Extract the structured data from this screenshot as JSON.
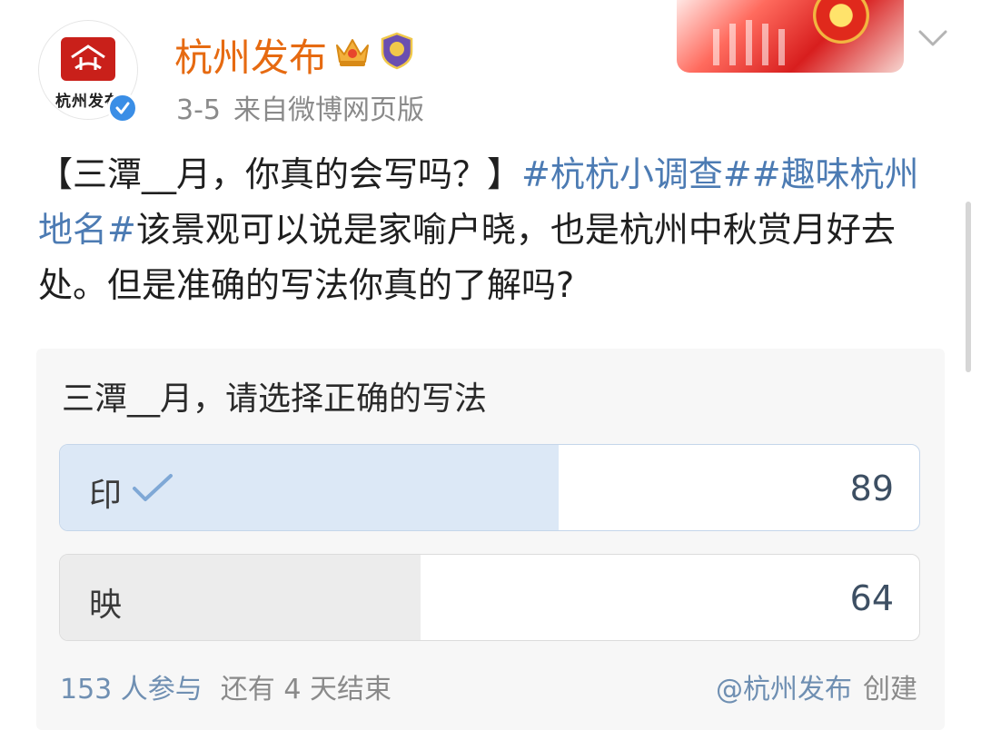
{
  "post_header": {
    "username": "杭州发布",
    "avatar_text": "杭州发布",
    "date": "3-5",
    "source": "来自微博网页版",
    "badges": [
      "crown-badge-icon",
      "shield-badge-icon"
    ]
  },
  "post": {
    "segments": [
      {
        "text": "【三潭__月，你真的会写吗？】",
        "type": "text"
      },
      {
        "text": "#杭杭小调查#",
        "type": "tag"
      },
      {
        "text": "#趣味杭州地名#",
        "type": "tag"
      },
      {
        "text": "该景观可以说是家喻户晓，也是杭州中秋赏月好去处。但是准确的写法你真的了解吗?",
        "type": "text"
      }
    ]
  },
  "poll": {
    "question": "三潭__月，请选择正确的写法",
    "options": [
      {
        "label": "印",
        "count": "89",
        "voted": true,
        "fraction": 0.58
      },
      {
        "label": "映",
        "count": "64",
        "voted": false,
        "fraction": 0.42
      }
    ],
    "participants": "153 人参与",
    "remaining": "还有 4 天结束",
    "creator": "@杭州发布",
    "created_label": "创建"
  },
  "colors": {
    "username": "#e66a11",
    "hashtag": "#4c7bb3",
    "voted_fill": "#dce8f6",
    "other_fill": "#ececec",
    "checkmark": "#7fa8d6",
    "footer_link": "#6f8fb2"
  }
}
